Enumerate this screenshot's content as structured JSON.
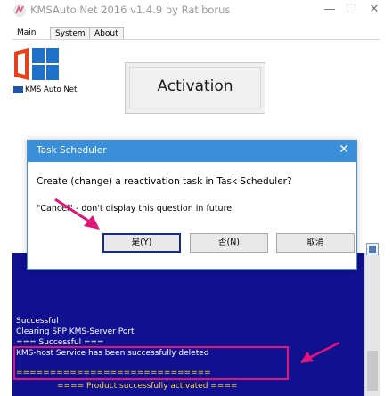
{
  "app": {
    "title": "KMSAuto Net 2016 v1.4.9 by Ratiborus",
    "minimize_glyph": "—",
    "maximize_glyph": "☐",
    "close_glyph": "✕"
  },
  "tabs": [
    {
      "label": "Main"
    },
    {
      "label": "System"
    },
    {
      "label": "About"
    }
  ],
  "logo": {
    "caption": "KMS Auto Net"
  },
  "activation": {
    "label": "Activation"
  },
  "log": {
    "lines": [
      "Successful",
      "Clearing SPP KMS-Server Port",
      "=== Successful ===",
      "KMS-host Service has been successfully deleted",
      "=============================",
      "====     Product successfully activated     ===="
    ]
  },
  "dialog": {
    "title": "Task Scheduler",
    "close_glyph": "✕",
    "question": "Create (change) a reactivation task in Task Scheduler?",
    "hint": "\"Cancel\" - don't display this question in future.",
    "yes_label": "是(Y)",
    "no_label": "否(N)",
    "cancel_label": "取消"
  },
  "colors": {
    "dialog_title_bg": "#3a8fd8",
    "log_bg": "#101090",
    "annotation": "#e0157a"
  }
}
